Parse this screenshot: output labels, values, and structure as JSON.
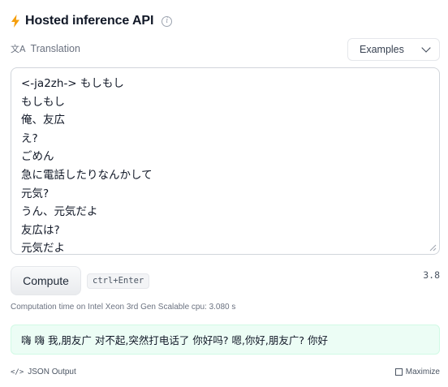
{
  "header": {
    "title": "Hosted inference API",
    "icon_color": "#f59e0b"
  },
  "task": {
    "label": "Translation"
  },
  "examples": {
    "label": "Examples"
  },
  "input": {
    "lines": [
      "<-ja2zh-> もしもし",
      "もしもし",
      "俺、友広",
      "え?",
      "ごめん",
      "急に電話したりなんかして",
      "元気?",
      "うん、元気だよ",
      "友広は?",
      "元気だよ"
    ]
  },
  "compute": {
    "button_label": "Compute",
    "shortcut": "ctrl+Enter",
    "version": "3.8"
  },
  "computation_time": "Computation time on Intel Xeon 3rd Gen Scalable cpu: 3.080 s",
  "output": {
    "text": "嗨 嗨 我,朋友广 对不起,突然打电话了 你好吗? 嗯,你好,朋友广? 你好"
  },
  "footer": {
    "json_output_label": "JSON Output",
    "maximize_label": "Maximize"
  }
}
